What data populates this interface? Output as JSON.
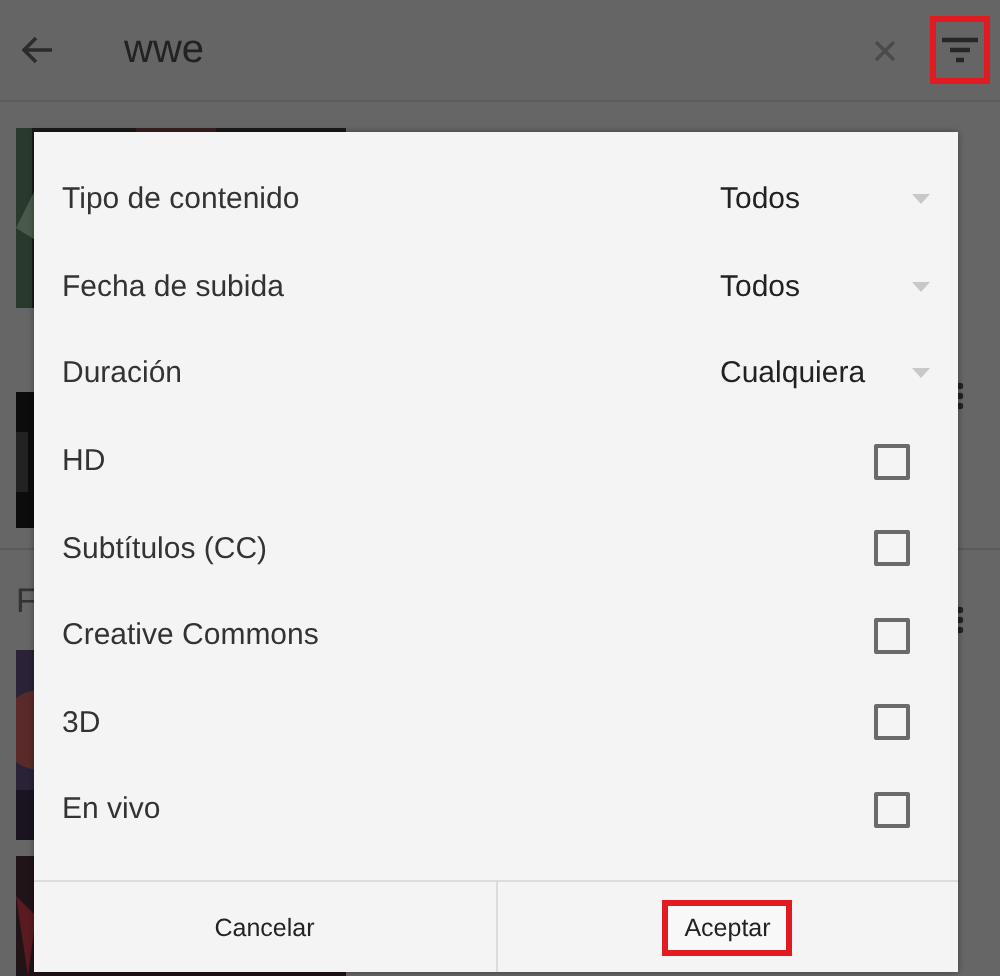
{
  "search_bar": {
    "query": "wwe",
    "filter_button": {
      "highlighted": true
    }
  },
  "results": {
    "section_heading": "F"
  },
  "filter_dialog": {
    "options": [
      {
        "kind": "dropdown",
        "label": "Tipo de contenido",
        "value": "Todos"
      },
      {
        "kind": "dropdown",
        "label": "Fecha de subida",
        "value": "Todos"
      },
      {
        "kind": "dropdown",
        "label": "Duración",
        "value": "Cualquiera"
      },
      {
        "kind": "checkbox",
        "label": "HD",
        "checked": false
      },
      {
        "kind": "checkbox",
        "label": "Subtítulos (CC)",
        "checked": false
      },
      {
        "kind": "checkbox",
        "label": "Creative Commons",
        "checked": false
      },
      {
        "kind": "checkbox",
        "label": "3D",
        "checked": false
      },
      {
        "kind": "checkbox",
        "label": "En vivo",
        "checked": false
      }
    ],
    "buttons": [
      {
        "label": "Cancelar",
        "highlighted": false
      },
      {
        "label": "Aceptar",
        "highlighted": true
      }
    ]
  }
}
